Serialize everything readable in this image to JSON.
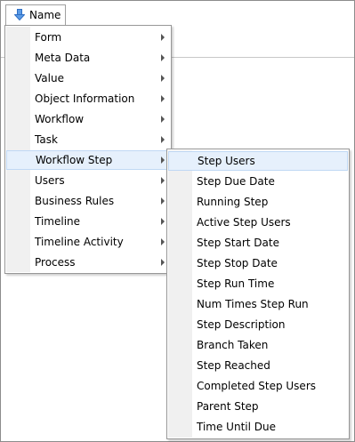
{
  "column_header": {
    "label": "Name",
    "sort_icon": "down-arrow-icon"
  },
  "primary_menu": {
    "items": [
      {
        "label": "Form",
        "has_submenu": true
      },
      {
        "label": "Meta Data",
        "has_submenu": true
      },
      {
        "label": "Value",
        "has_submenu": true
      },
      {
        "label": "Object Information",
        "has_submenu": true
      },
      {
        "label": "Workflow",
        "has_submenu": true
      },
      {
        "label": "Task",
        "has_submenu": true
      },
      {
        "label": "Workflow Step",
        "has_submenu": true,
        "highlighted": true
      },
      {
        "label": "Users",
        "has_submenu": true
      },
      {
        "label": "Business Rules",
        "has_submenu": true
      },
      {
        "label": "Timeline",
        "has_submenu": true
      },
      {
        "label": "Timeline Activity",
        "has_submenu": true
      },
      {
        "label": "Process",
        "has_submenu": true
      }
    ]
  },
  "sub_menu": {
    "parent": "Workflow Step",
    "items": [
      {
        "label": "Step Users",
        "highlighted": true
      },
      {
        "label": "Step Due Date"
      },
      {
        "label": "Running Step"
      },
      {
        "label": "Active Step Users"
      },
      {
        "label": "Step Start Date"
      },
      {
        "label": "Step Stop Date"
      },
      {
        "label": "Step Run Time"
      },
      {
        "label": "Num Times Step Run"
      },
      {
        "label": "Step Description"
      },
      {
        "label": "Branch Taken"
      },
      {
        "label": "Step Reached"
      },
      {
        "label": "Completed Step Users"
      },
      {
        "label": "Parent Step"
      },
      {
        "label": "Time Until Due"
      }
    ]
  },
  "colors": {
    "highlight_background": "#e6f0fc",
    "highlight_border": "#c0d8f4",
    "gutter": "#f0f0f0",
    "menu_border": "#979797",
    "sort_arrow": "#3d7bd6"
  }
}
